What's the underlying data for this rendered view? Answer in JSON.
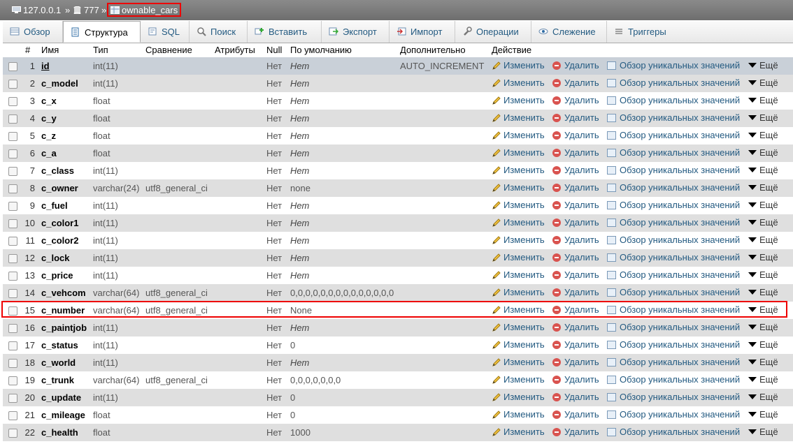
{
  "breadcrumb": {
    "server": "127.0.0.1",
    "database": "777",
    "table": "ownable_cars",
    "separator": "»"
  },
  "tabs": [
    {
      "label": "Обзор",
      "icon": "browse-icon"
    },
    {
      "label": "Структура",
      "icon": "structure-icon",
      "active": true
    },
    {
      "label": "SQL",
      "icon": "sql-icon"
    },
    {
      "label": "Поиск",
      "icon": "search-icon"
    },
    {
      "label": "Вставить",
      "icon": "insert-icon"
    },
    {
      "label": "Экспорт",
      "icon": "export-icon"
    },
    {
      "label": "Импорт",
      "icon": "import-icon"
    },
    {
      "label": "Операции",
      "icon": "wrench-icon"
    },
    {
      "label": "Слежение",
      "icon": "eye-icon"
    },
    {
      "label": "Триггеры",
      "icon": "triggers-icon"
    }
  ],
  "table": {
    "headers": {
      "num": "#",
      "name": "Имя",
      "type": "Тип",
      "collation": "Сравнение",
      "attributes": "Атрибуты",
      "null": "Null",
      "default": "По умолчанию",
      "extra": "Дополнительно",
      "action": "Действие"
    },
    "actions": {
      "change": "Изменить",
      "drop": "Удалить",
      "distinct": "Обзор уникальных значений",
      "more": "Ещё"
    },
    "rows": [
      {
        "num": "1",
        "name": "id",
        "type": "int(11)",
        "collation": "",
        "null": "Нет",
        "default": "Нет",
        "extra": "AUTO_INCREMENT"
      },
      {
        "num": "2",
        "name": "c_model",
        "type": "int(11)",
        "collation": "",
        "null": "Нет",
        "default": "Нет",
        "extra": ""
      },
      {
        "num": "3",
        "name": "c_x",
        "type": "float",
        "collation": "",
        "null": "Нет",
        "default": "Нет",
        "extra": ""
      },
      {
        "num": "4",
        "name": "c_y",
        "type": "float",
        "collation": "",
        "null": "Нет",
        "default": "Нет",
        "extra": ""
      },
      {
        "num": "5",
        "name": "c_z",
        "type": "float",
        "collation": "",
        "null": "Нет",
        "default": "Нет",
        "extra": ""
      },
      {
        "num": "6",
        "name": "c_a",
        "type": "float",
        "collation": "",
        "null": "Нет",
        "default": "Нет",
        "extra": ""
      },
      {
        "num": "7",
        "name": "c_class",
        "type": "int(11)",
        "collation": "",
        "null": "Нет",
        "default": "Нет",
        "extra": ""
      },
      {
        "num": "8",
        "name": "c_owner",
        "type": "varchar(24)",
        "collation": "utf8_general_ci",
        "null": "Нет",
        "default": "none",
        "extra": ""
      },
      {
        "num": "9",
        "name": "c_fuel",
        "type": "int(11)",
        "collation": "",
        "null": "Нет",
        "default": "Нет",
        "extra": ""
      },
      {
        "num": "10",
        "name": "c_color1",
        "type": "int(11)",
        "collation": "",
        "null": "Нет",
        "default": "Нет",
        "extra": ""
      },
      {
        "num": "11",
        "name": "c_color2",
        "type": "int(11)",
        "collation": "",
        "null": "Нет",
        "default": "Нет",
        "extra": ""
      },
      {
        "num": "12",
        "name": "c_lock",
        "type": "int(11)",
        "collation": "",
        "null": "Нет",
        "default": "Нет",
        "extra": ""
      },
      {
        "num": "13",
        "name": "c_price",
        "type": "int(11)",
        "collation": "",
        "null": "Нет",
        "default": "Нет",
        "extra": ""
      },
      {
        "num": "14",
        "name": "c_vehcom",
        "type": "varchar(64)",
        "collation": "utf8_general_ci",
        "null": "Нет",
        "default": "0,0,0,0,0,0,0,0,0,0,0,0,0,0",
        "extra": ""
      },
      {
        "num": "15",
        "name": "c_number",
        "type": "varchar(64)",
        "collation": "utf8_general_ci",
        "null": "Нет",
        "default": "None",
        "extra": ""
      },
      {
        "num": "16",
        "name": "c_paintjob",
        "type": "int(11)",
        "collation": "",
        "null": "Нет",
        "default": "Нет",
        "extra": ""
      },
      {
        "num": "17",
        "name": "c_status",
        "type": "int(11)",
        "collation": "",
        "null": "Нет",
        "default": "0",
        "extra": ""
      },
      {
        "num": "18",
        "name": "c_world",
        "type": "int(11)",
        "collation": "",
        "null": "Нет",
        "default": "Нет",
        "extra": ""
      },
      {
        "num": "19",
        "name": "c_trunk",
        "type": "varchar(64)",
        "collation": "utf8_general_ci",
        "null": "Нет",
        "default": "0,0,0,0,0,0,0",
        "extra": ""
      },
      {
        "num": "20",
        "name": "c_update",
        "type": "int(11)",
        "collation": "",
        "null": "Нет",
        "default": "0",
        "extra": ""
      },
      {
        "num": "21",
        "name": "c_mileage",
        "type": "float",
        "collation": "",
        "null": "Нет",
        "default": "0",
        "extra": ""
      },
      {
        "num": "22",
        "name": "c_health",
        "type": "float",
        "collation": "",
        "null": "Нет",
        "default": "1000",
        "extra": ""
      }
    ]
  }
}
